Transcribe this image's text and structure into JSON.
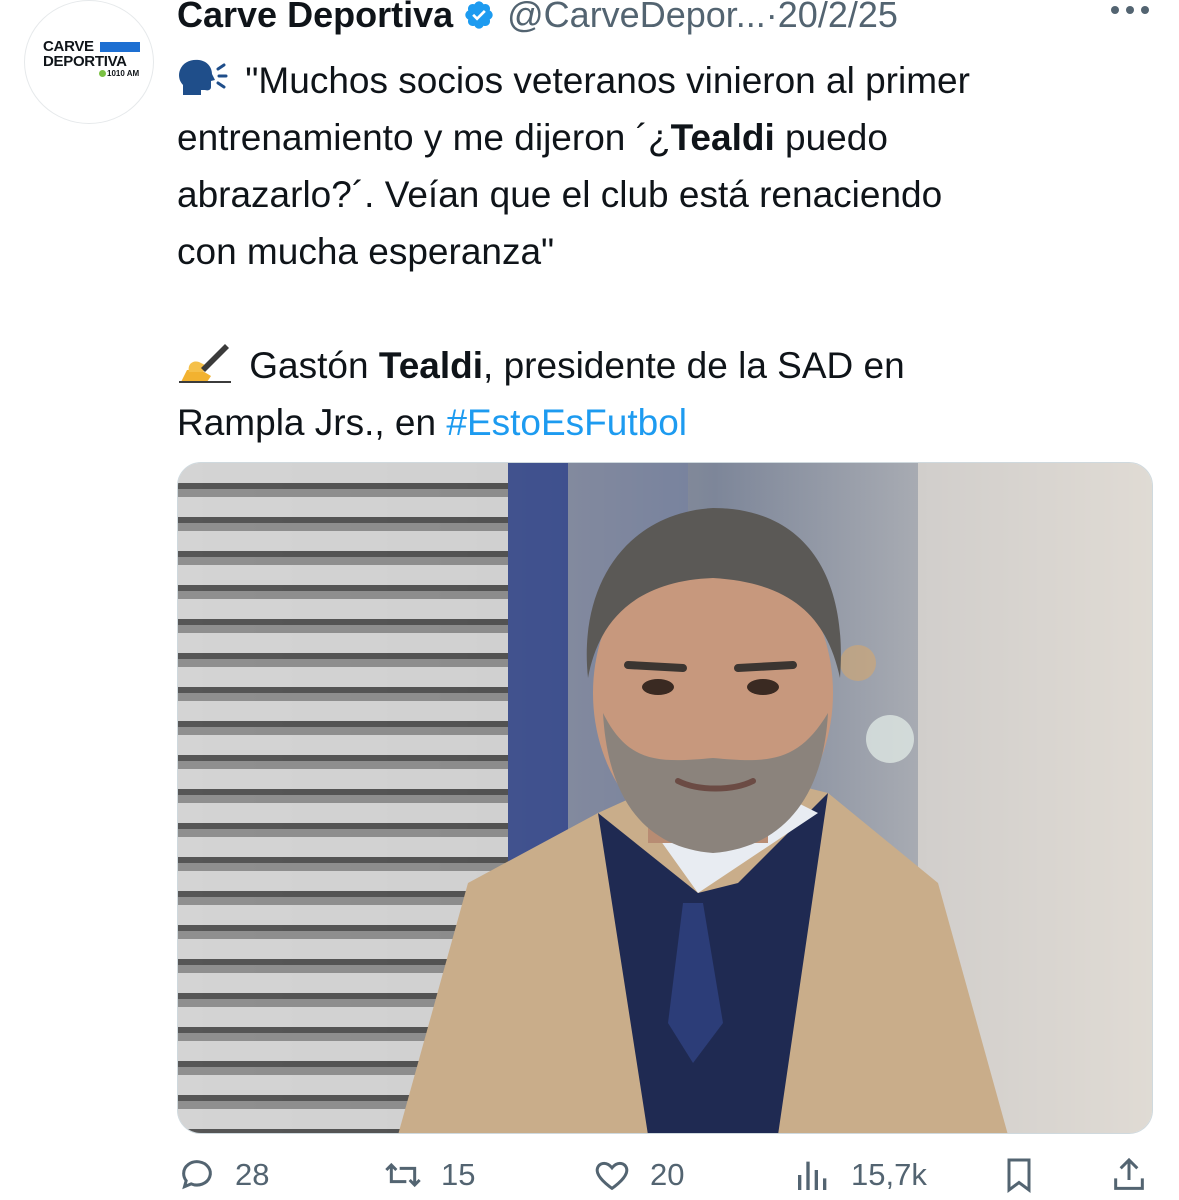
{
  "account": {
    "name": "Carve Deportiva",
    "handle": "@CarveDepor...",
    "separator": "·",
    "date": "20/2/25",
    "avatar_logo": {
      "line1": "CARVE",
      "line2": "DEPORTIVA",
      "line3": "1010 AM"
    }
  },
  "tweet": {
    "quote_lines": [
      "\"Muchos socios veteranos vinieron al primer",
      "entrenamiento y me dijeron ´¿Tealdi puedo",
      "abrazarlo?´. Veían que el club está renaciendo",
      "con mucha esperanza\""
    ],
    "author_prefix": "Gastón ",
    "author_bold": "Tealdi",
    "author_suffix": ", presidente de la SAD en",
    "line2_prefix": "Rampla Jrs., en ",
    "hashtag": "#EstoEsFutbol",
    "bold_word": "Tealdi"
  },
  "actions": {
    "replies": "28",
    "reposts": "15",
    "likes": "20",
    "views": "15,7k"
  },
  "colors": {
    "text": "#0f1419",
    "muted": "#536471",
    "link": "#1d9bf0",
    "verified": "#1d9bf0"
  },
  "icons": [
    "speaking-head-icon",
    "verified-badge-icon",
    "more-icon",
    "writing-hand-icon",
    "reply-icon",
    "repost-icon",
    "like-icon",
    "views-icon",
    "bookmark-icon",
    "share-icon"
  ]
}
